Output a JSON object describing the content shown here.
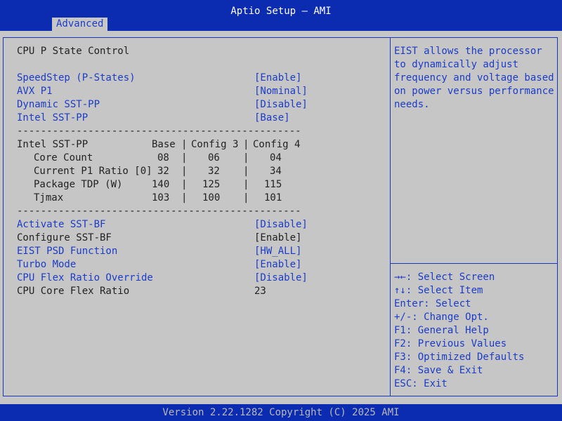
{
  "window": {
    "title": "Aptio Setup – AMI",
    "tab": "Advanced"
  },
  "section_title": "CPU P State Control",
  "settings_top": [
    {
      "label": "SpeedStep (P-States)",
      "value": "[Enable]"
    },
    {
      "label": "AVX P1",
      "value": "[Nominal]"
    },
    {
      "label": "Dynamic SST-PP",
      "value": "[Disable]"
    },
    {
      "label": "Intel SST-PP",
      "value": "[Base]"
    }
  ],
  "separator": "------------------------------------------------",
  "sst_table": {
    "header": {
      "name": "Intel SST-PP",
      "c1": "Base",
      "c2": "Config 3",
      "c3": "Config 4"
    },
    "rows": [
      {
        "name": "Core Count",
        "c1": "08",
        "c2": "06",
        "c3": "04"
      },
      {
        "name": "Current P1 Ratio [0]",
        "c1": "32",
        "c2": "32",
        "c3": "34"
      },
      {
        "name": "Package TDP (W)",
        "c1": "140",
        "c2": "125",
        "c3": "115"
      },
      {
        "name": "Tjmax",
        "c1": "103",
        "c2": "100",
        "c3": "101"
      }
    ],
    "pipe": "|"
  },
  "settings_bottom": [
    {
      "label": "Activate SST-BF",
      "value": "[Disable]",
      "selectable": true
    },
    {
      "label": "Configure SST-BF",
      "value": "[Enable]",
      "selectable": false
    },
    {
      "label": "EIST PSD Function",
      "value": "[HW_ALL]",
      "selectable": true
    },
    {
      "label": "Turbo Mode",
      "value": "[Enable]",
      "selectable": true
    },
    {
      "label": "CPU Flex Ratio Override",
      "value": "[Disable]",
      "selectable": true
    },
    {
      "label": "CPU Core Flex Ratio",
      "value": "23",
      "selectable": false
    }
  ],
  "help_text": "EIST allows the processor to dynamically adjust frequency and voltage based on power versus performance needs.",
  "key_help": [
    "→←: Select Screen",
    "↑↓: Select Item",
    "Enter: Select",
    "+/-: Change Opt.",
    "F1: General Help",
    "F2: Previous Values",
    "F3: Optimized Defaults",
    "F4: Save & Exit",
    "ESC: Exit"
  ],
  "version": "Version 2.22.1282 Copyright (C) 2025 AMI",
  "colors": {
    "bar": "#0b2cb0",
    "background": "#c6c6c6",
    "accent": "#1c3cc8"
  }
}
